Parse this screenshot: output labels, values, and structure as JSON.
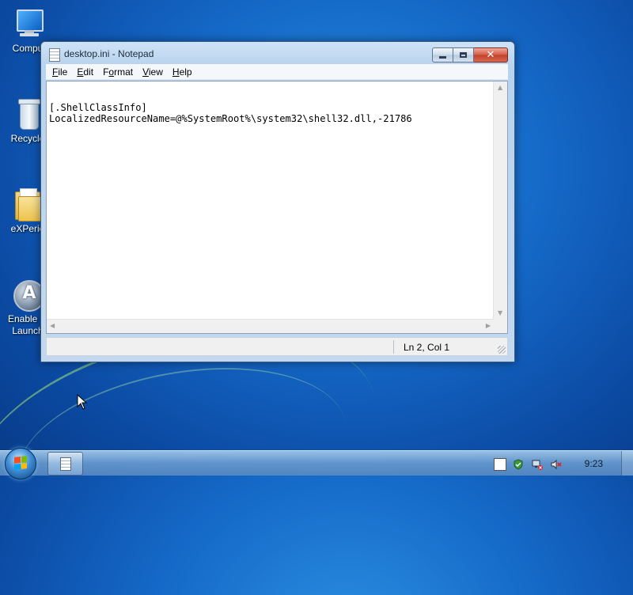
{
  "desktop": {
    "icons": [
      {
        "label": "Compu"
      },
      {
        "label": "Recycle"
      },
      {
        "label": "eXPerie"
      },
      {
        "label": "Enable Q",
        "label2": "Launch"
      }
    ]
  },
  "window": {
    "title": "desktop.ini - Notepad",
    "menu": [
      {
        "label": "File",
        "accel": "F",
        "rest": "ile"
      },
      {
        "label": "Edit",
        "accel": "E",
        "rest": "dit"
      },
      {
        "label": "Format",
        "accel": "o",
        "pre": "F",
        "rest": "rmat"
      },
      {
        "label": "View",
        "accel": "V",
        "rest": "iew"
      },
      {
        "label": "Help",
        "accel": "H",
        "rest": "elp"
      }
    ],
    "content_lines": [
      "[.ShellClassInfo]",
      "LocalizedResourceName=@%SystemRoot%\\system32\\shell32.dll,-21786"
    ],
    "status": {
      "position": "Ln 2, Col 1"
    }
  },
  "taskbar": {
    "clock": "9:23"
  },
  "colors": {
    "desktop_bg": "#1569c8",
    "close_button": "#c13f29",
    "window_frame": "#b8d3ee"
  }
}
